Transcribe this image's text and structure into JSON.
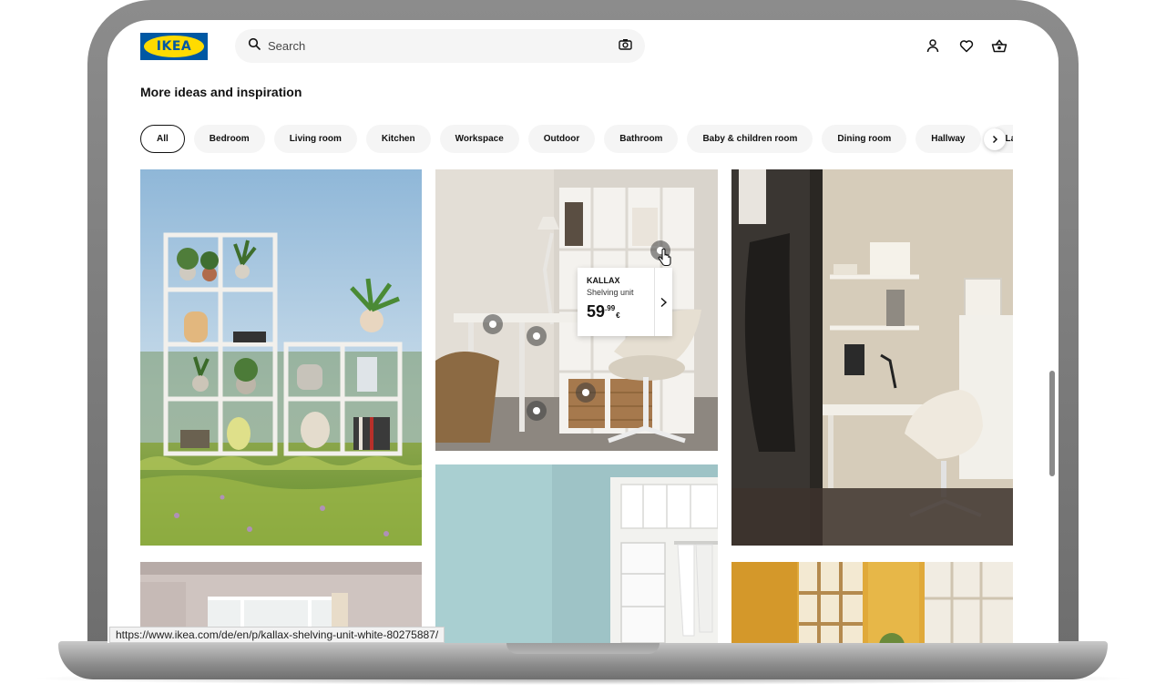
{
  "header": {
    "logo_text": "IKEA",
    "search_placeholder": "Search",
    "icons": [
      "camera-icon",
      "user-icon",
      "heart-icon",
      "basket-icon"
    ]
  },
  "section": {
    "title": "More ideas and inspiration"
  },
  "chips": [
    {
      "label": "All",
      "active": true
    },
    {
      "label": "Bedroom"
    },
    {
      "label": "Living room"
    },
    {
      "label": "Kitchen"
    },
    {
      "label": "Workspace"
    },
    {
      "label": "Outdoor"
    },
    {
      "label": "Bathroom"
    },
    {
      "label": "Baby & children room"
    },
    {
      "label": "Dining room"
    },
    {
      "label": "Hallway"
    },
    {
      "label": "La"
    }
  ],
  "product_card": {
    "name": "KALLAX",
    "type": "Shelving unit",
    "price_int": "59",
    "price_dec": ".99",
    "currency": "€"
  },
  "status_url": "https://www.ikea.com/de/en/p/kallax-shelving-unit-white-80275887/",
  "colors": {
    "brand_blue": "#0058a3",
    "brand_yellow": "#ffdb00"
  }
}
